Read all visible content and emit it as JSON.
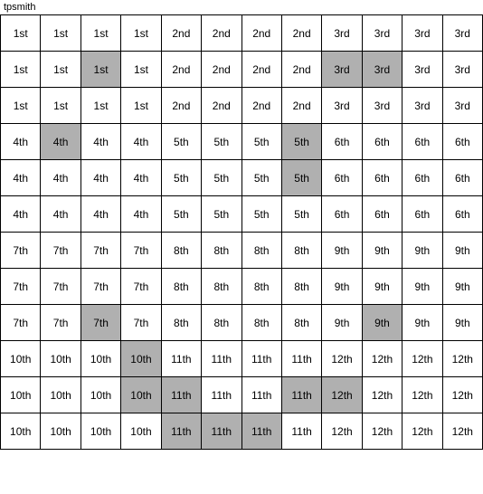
{
  "title": "tpsmith",
  "rows": [
    [
      {
        "text": "1st",
        "h": false
      },
      {
        "text": "1st",
        "h": false
      },
      {
        "text": "1st",
        "h": false
      },
      {
        "text": "1st",
        "h": false
      },
      {
        "text": "2nd",
        "h": false
      },
      {
        "text": "2nd",
        "h": false
      },
      {
        "text": "2nd",
        "h": false
      },
      {
        "text": "2nd",
        "h": false
      },
      {
        "text": "3rd",
        "h": false
      },
      {
        "text": "3rd",
        "h": false
      },
      {
        "text": "3rd",
        "h": false
      },
      {
        "text": "3rd",
        "h": false
      }
    ],
    [
      {
        "text": "1st",
        "h": false
      },
      {
        "text": "1st",
        "h": false
      },
      {
        "text": "1st",
        "h": true
      },
      {
        "text": "1st",
        "h": false
      },
      {
        "text": "2nd",
        "h": false
      },
      {
        "text": "2nd",
        "h": false
      },
      {
        "text": "2nd",
        "h": false
      },
      {
        "text": "2nd",
        "h": false
      },
      {
        "text": "3rd",
        "h": true
      },
      {
        "text": "3rd",
        "h": true
      },
      {
        "text": "3rd",
        "h": false
      },
      {
        "text": "3rd",
        "h": false
      }
    ],
    [
      {
        "text": "1st",
        "h": false
      },
      {
        "text": "1st",
        "h": false
      },
      {
        "text": "1st",
        "h": false
      },
      {
        "text": "1st",
        "h": false
      },
      {
        "text": "2nd",
        "h": false
      },
      {
        "text": "2nd",
        "h": false
      },
      {
        "text": "2nd",
        "h": false
      },
      {
        "text": "2nd",
        "h": false
      },
      {
        "text": "3rd",
        "h": false
      },
      {
        "text": "3rd",
        "h": false
      },
      {
        "text": "3rd",
        "h": false
      },
      {
        "text": "3rd",
        "h": false
      }
    ],
    [
      {
        "text": "4th",
        "h": false
      },
      {
        "text": "4th",
        "h": true
      },
      {
        "text": "4th",
        "h": false
      },
      {
        "text": "4th",
        "h": false
      },
      {
        "text": "5th",
        "h": false
      },
      {
        "text": "5th",
        "h": false
      },
      {
        "text": "5th",
        "h": false
      },
      {
        "text": "5th",
        "h": true
      },
      {
        "text": "6th",
        "h": false
      },
      {
        "text": "6th",
        "h": false
      },
      {
        "text": "6th",
        "h": false
      },
      {
        "text": "6th",
        "h": false
      }
    ],
    [
      {
        "text": "4th",
        "h": false
      },
      {
        "text": "4th",
        "h": false
      },
      {
        "text": "4th",
        "h": false
      },
      {
        "text": "4th",
        "h": false
      },
      {
        "text": "5th",
        "h": false
      },
      {
        "text": "5th",
        "h": false
      },
      {
        "text": "5th",
        "h": false
      },
      {
        "text": "5th",
        "h": true
      },
      {
        "text": "6th",
        "h": false
      },
      {
        "text": "6th",
        "h": false
      },
      {
        "text": "6th",
        "h": false
      },
      {
        "text": "6th",
        "h": false
      }
    ],
    [
      {
        "text": "4th",
        "h": false
      },
      {
        "text": "4th",
        "h": false
      },
      {
        "text": "4th",
        "h": false
      },
      {
        "text": "4th",
        "h": false
      },
      {
        "text": "5th",
        "h": false
      },
      {
        "text": "5th",
        "h": false
      },
      {
        "text": "5th",
        "h": false
      },
      {
        "text": "5th",
        "h": false
      },
      {
        "text": "6th",
        "h": false
      },
      {
        "text": "6th",
        "h": false
      },
      {
        "text": "6th",
        "h": false
      },
      {
        "text": "6th",
        "h": false
      }
    ],
    [
      {
        "text": "7th",
        "h": false
      },
      {
        "text": "7th",
        "h": false
      },
      {
        "text": "7th",
        "h": false
      },
      {
        "text": "7th",
        "h": false
      },
      {
        "text": "8th",
        "h": false
      },
      {
        "text": "8th",
        "h": false
      },
      {
        "text": "8th",
        "h": false
      },
      {
        "text": "8th",
        "h": false
      },
      {
        "text": "9th",
        "h": false
      },
      {
        "text": "9th",
        "h": false
      },
      {
        "text": "9th",
        "h": false
      },
      {
        "text": "9th",
        "h": false
      }
    ],
    [
      {
        "text": "7th",
        "h": false
      },
      {
        "text": "7th",
        "h": false
      },
      {
        "text": "7th",
        "h": false
      },
      {
        "text": "7th",
        "h": false
      },
      {
        "text": "8th",
        "h": false
      },
      {
        "text": "8th",
        "h": false
      },
      {
        "text": "8th",
        "h": false
      },
      {
        "text": "8th",
        "h": false
      },
      {
        "text": "9th",
        "h": false
      },
      {
        "text": "9th",
        "h": false
      },
      {
        "text": "9th",
        "h": false
      },
      {
        "text": "9th",
        "h": false
      }
    ],
    [
      {
        "text": "7th",
        "h": false
      },
      {
        "text": "7th",
        "h": false
      },
      {
        "text": "7th",
        "h": true
      },
      {
        "text": "7th",
        "h": false
      },
      {
        "text": "8th",
        "h": false
      },
      {
        "text": "8th",
        "h": false
      },
      {
        "text": "8th",
        "h": false
      },
      {
        "text": "8th",
        "h": false
      },
      {
        "text": "9th",
        "h": false
      },
      {
        "text": "9th",
        "h": true
      },
      {
        "text": "9th",
        "h": false
      },
      {
        "text": "9th",
        "h": false
      }
    ],
    [
      {
        "text": "10th",
        "h": false
      },
      {
        "text": "10th",
        "h": false
      },
      {
        "text": "10th",
        "h": false
      },
      {
        "text": "10th",
        "h": true
      },
      {
        "text": "11th",
        "h": false
      },
      {
        "text": "11th",
        "h": false
      },
      {
        "text": "11th",
        "h": false
      },
      {
        "text": "11th",
        "h": false
      },
      {
        "text": "12th",
        "h": false
      },
      {
        "text": "12th",
        "h": false
      },
      {
        "text": "12th",
        "h": false
      },
      {
        "text": "12th",
        "h": false
      }
    ],
    [
      {
        "text": "10th",
        "h": false
      },
      {
        "text": "10th",
        "h": false
      },
      {
        "text": "10th",
        "h": false
      },
      {
        "text": "10th",
        "h": true
      },
      {
        "text": "11th",
        "h": true
      },
      {
        "text": "11th",
        "h": false
      },
      {
        "text": "11th",
        "h": false
      },
      {
        "text": "11th",
        "h": true
      },
      {
        "text": "12th",
        "h": true
      },
      {
        "text": "12th",
        "h": false
      },
      {
        "text": "12th",
        "h": false
      },
      {
        "text": "12th",
        "h": false
      }
    ],
    [
      {
        "text": "10th",
        "h": false
      },
      {
        "text": "10th",
        "h": false
      },
      {
        "text": "10th",
        "h": false
      },
      {
        "text": "10th",
        "h": false
      },
      {
        "text": "11th",
        "h": true
      },
      {
        "text": "11th",
        "h": true
      },
      {
        "text": "11th",
        "h": true
      },
      {
        "text": "11th",
        "h": false
      },
      {
        "text": "12th",
        "h": false
      },
      {
        "text": "12th",
        "h": false
      },
      {
        "text": "12th",
        "h": false
      },
      {
        "text": "12th",
        "h": false
      }
    ]
  ]
}
